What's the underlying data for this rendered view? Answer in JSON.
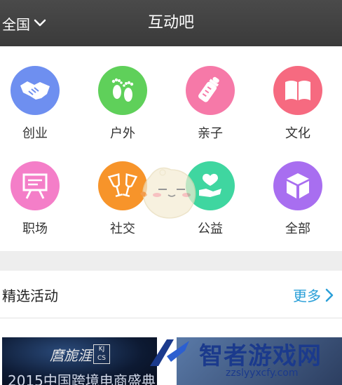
{
  "header": {
    "region_label": "全国",
    "title": "互动吧",
    "bg_color": "#3f3f3f"
  },
  "categories": [
    {
      "label": "创业",
      "icon": "handshake-icon",
      "color": "#6e8ff0"
    },
    {
      "label": "户外",
      "icon": "footprints-icon",
      "color": "#5fd05a"
    },
    {
      "label": "亲子",
      "icon": "baby-bottle-icon",
      "color": "#f679a8"
    },
    {
      "label": "文化",
      "icon": "book-icon",
      "color": "#f66a80"
    },
    {
      "label": "职场",
      "icon": "presentation-board-icon",
      "color": "#f47ec8"
    },
    {
      "label": "社交",
      "icon": "cheers-glasses-icon",
      "color": "#f7942a"
    },
    {
      "label": "公益",
      "icon": "heart-hand-icon",
      "color": "#3fd6a0"
    },
    {
      "label": "全部",
      "icon": "cube-icon",
      "color": "#a86ef0"
    }
  ],
  "featured": {
    "title": "精选活动",
    "more_label": "更多",
    "more_color": "#2a9fd8"
  },
  "banners": [
    {
      "calligraphy": "麿旎涯",
      "badge": "KJ CS",
      "text": "2015中国跨境电商盛典"
    }
  ],
  "watermark": {
    "name": "智者游戏网",
    "url": "zzslyyxcfy.com"
  }
}
